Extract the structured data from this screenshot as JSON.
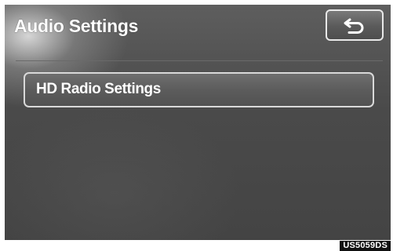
{
  "screen": {
    "title": "Audio Settings",
    "back_button": {
      "icon": "back-arrow-icon"
    },
    "items": [
      {
        "label": "HD Radio Settings"
      }
    ]
  },
  "caption": "US5059DS",
  "colors": {
    "screen_background": "#4a4a4a",
    "text": "#ffffff",
    "button_border": "#d9d9d9"
  }
}
